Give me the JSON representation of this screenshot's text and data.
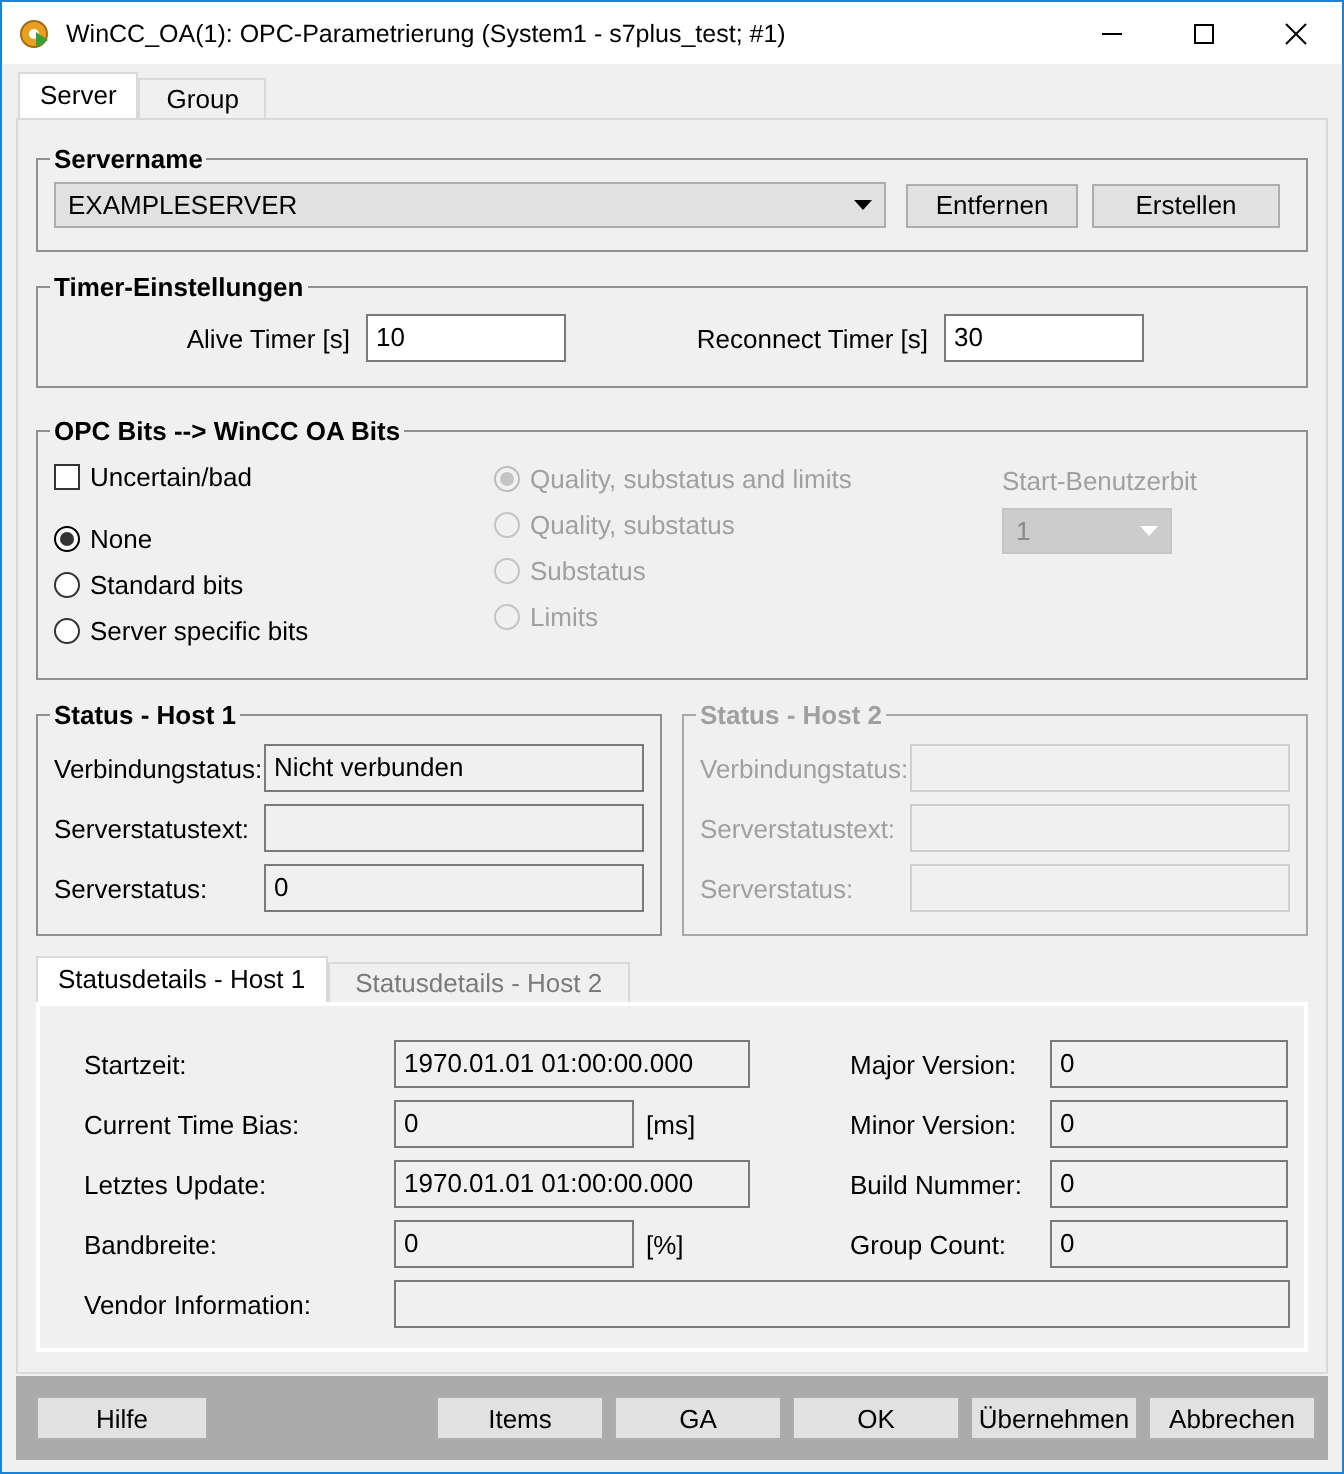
{
  "window": {
    "title": "WinCC_OA(1): OPC-Parametrierung (System1 - s7plus_test; #1)"
  },
  "tabs": [
    {
      "label": "Server",
      "selected": true
    },
    {
      "label": "Group",
      "selected": false
    }
  ],
  "servername": {
    "title": "Servername",
    "dropdown": {
      "value": "EXAMPLESERVER"
    },
    "buttons": [
      "Entfernen",
      "Erstellen"
    ]
  },
  "timer": {
    "title": "Timer-Einstellungen",
    "fields": [
      {
        "label": "Alive Timer [s]",
        "value": "10"
      },
      {
        "label": "Reconnect Timer [s]",
        "value": "30"
      }
    ]
  },
  "opc_bits": {
    "title": "OPC Bits --> WinCC OA Bits",
    "checkbox": {
      "label": "Uncertain/bad",
      "checked": false
    },
    "mapping": [
      {
        "label": "None",
        "selected": true,
        "disabled": false
      },
      {
        "label": "Standard bits",
        "selected": false,
        "disabled": false
      },
      {
        "label": "Server specific bits",
        "selected": false,
        "disabled": false
      }
    ],
    "quality": [
      {
        "label": "Quality, substatus and limits",
        "selected": true,
        "disabled": true
      },
      {
        "label": "Quality, substatus",
        "selected": false,
        "disabled": true
      },
      {
        "label": "Substatus",
        "selected": false,
        "disabled": true
      },
      {
        "label": "Limits",
        "selected": false,
        "disabled": true
      }
    ],
    "start_bit": {
      "label": "Start-Benutzerbit",
      "value": "1",
      "disabled": true
    }
  },
  "status_hosts": [
    {
      "title": "Status - Host 1",
      "disabled": false,
      "fields": [
        {
          "label": "Verbindungstatus:",
          "value": "Nicht verbunden"
        },
        {
          "label": "Serverstatustext:"
        },
        {
          "label": "Serverstatus:",
          "value": "0"
        }
      ]
    },
    {
      "title": "Status - Host 2",
      "disabled": true,
      "fields": [
        {
          "label": "Verbindungstatus:"
        },
        {
          "label": "Serverstatustext:"
        },
        {
          "label": "Serverstatus:"
        }
      ]
    }
  ],
  "detail_tabs": [
    {
      "label": "Statusdetails - Host 1",
      "selected": true
    },
    {
      "label": "Statusdetails - Host 2",
      "selected": false
    }
  ],
  "details": {
    "left": [
      {
        "label": "Startzeit:",
        "value": "1970.01.01 01:00:00.000"
      },
      {
        "label": "Current Time Bias:",
        "value": "0",
        "unit": "[ms]"
      },
      {
        "label": "Letztes Update:",
        "value": "1970.01.01 01:00:00.000"
      },
      {
        "label": "Bandbreite:",
        "value": "0",
        "unit": "[%]"
      }
    ],
    "right": [
      {
        "label": "Major Version:",
        "value": "0"
      },
      {
        "label": "Minor Version:",
        "value": "0"
      },
      {
        "label": "Build Nummer:",
        "value": "0"
      },
      {
        "label": "Group Count:",
        "value": "0"
      }
    ],
    "vendor": {
      "label": "Vendor Information:"
    }
  },
  "left_buttons": [
    "Hilfe"
  ],
  "right_buttons": [
    "Items",
    "GA",
    "OK",
    "Übernehmen",
    "Abbrechen"
  ]
}
